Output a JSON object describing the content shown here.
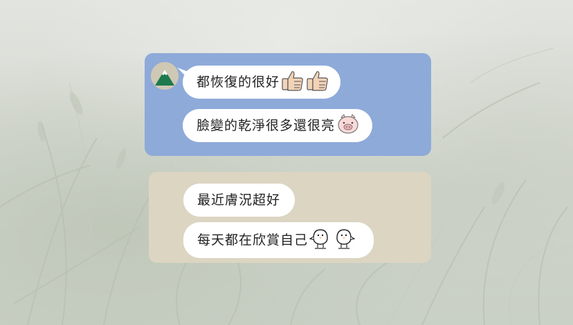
{
  "chat": {
    "group1": {
      "avatar_icon": "mountain-avatar-icon",
      "messages": [
        {
          "text": "都恢復的很好",
          "stickers": [
            "thumbs-up-icon",
            "thumbs-up-icon"
          ]
        },
        {
          "text": "臉變的乾淨很多還很亮",
          "stickers": [
            "pig-face-icon"
          ]
        }
      ]
    },
    "group2": {
      "messages": [
        {
          "text": "最近膚況超好",
          "stickers": []
        },
        {
          "text": "每天都在欣賞自己",
          "stickers": [
            "chick-icon",
            "chick-icon"
          ]
        }
      ]
    }
  },
  "colors": {
    "card_blue": "#8eaad9",
    "card_beige": "#dcd5c2",
    "bubble": "#ffffff",
    "text": "#222222"
  }
}
